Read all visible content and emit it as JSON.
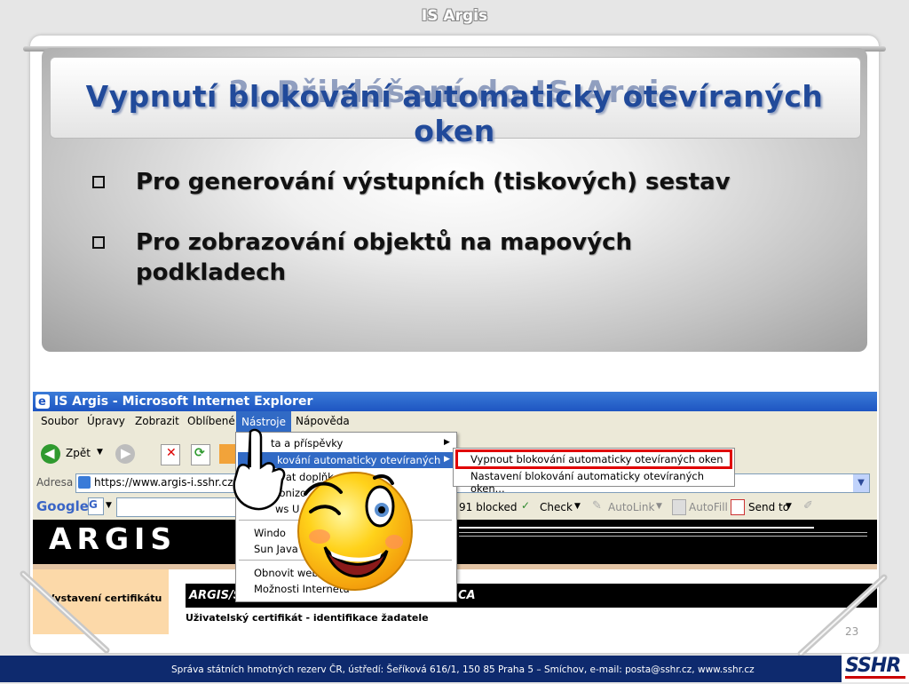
{
  "header": {
    "app_title": "IS Argis"
  },
  "slide": {
    "ghost_title": "2. Přihlášení do IS Argis",
    "title": "Vypnutí blokování automaticky otevíraných oken",
    "bullets": [
      "Pro generování výstupních (tiskových) sestav",
      "Pro zobrazování objektů na mapových podkladech"
    ],
    "page_number": "23"
  },
  "ie": {
    "window_title": "IS Argis - Microsoft Internet Explorer",
    "menu": [
      "Soubor",
      "Úpravy",
      "Zobrazit",
      "Oblíbené",
      "Nástroje",
      "Nápověda"
    ],
    "back_label": "Zpět",
    "address_label": "Adresa",
    "address_value": "https://www.argis-i.sshr.cz/ce",
    "google_label": "Google",
    "blocked_label": "91 blocked",
    "check_label": "Check",
    "autolink_label": "AutoLink",
    "autofill_label": "AutoFill",
    "sendto_label": "Send to",
    "site_logo": "ARGIS",
    "left_nav_item": "Vystavení certifikátu",
    "content_header": "ARGIS/S",
    "content_header_tail": "CA",
    "content_subtitle": "Uživatelský certifikát - identifikace žadatele",
    "dropdown": {
      "items": [
        "Pošta a příspěvky",
        "Blokování automaticky otevíraných oken",
        "Spravovat doplňky",
        "Synchronizovat",
        "Windows Update",
        "Windows Messenger",
        "Sun Java Console",
        "Obnovit webovou stránku",
        "Možnosti Internetu"
      ],
      "visible_fragments": [
        "P",
        "ta a příspěvky",
        "kování automaticky otevíraných oken",
        "ovat doplňk",
        "ronizo",
        "ws U",
        "Windo",
        "Sun Java",
        "Obnovit webo",
        "Možnosti Internetu"
      ]
    },
    "submenu": {
      "items": [
        "Vypnout blokování automaticky otevíraných oken",
        "Nastavení blokování automaticky otevíraných oken..."
      ],
      "highlight_color": "#e00000"
    }
  },
  "footer": {
    "text": "Správa státních hmotných rezerv ČR, ústředí: Šeříková 616/1, 150 85 Praha 5 – Smíchov, e-mail: posta@sshr.cz, www.sshr.cz",
    "logo_text": "SSHR"
  },
  "colors": {
    "title_blue": "#214a9a",
    "ie_titlebar": "#1e55c2",
    "footer_bg": "#0e2a6e"
  }
}
